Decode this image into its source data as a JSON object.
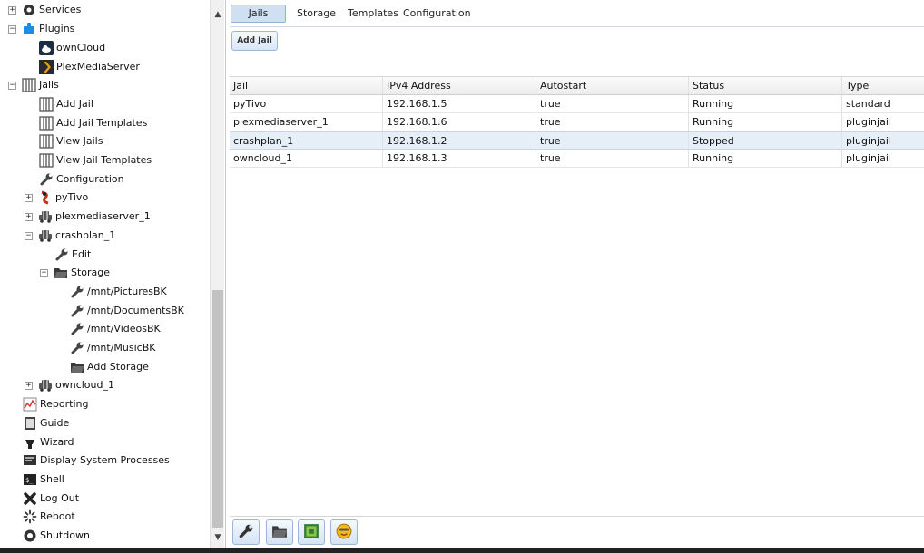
{
  "tree": {
    "items": [
      {
        "label": "Services",
        "icon": "services-gear-icon",
        "expander": "+"
      },
      {
        "label": "Plugins",
        "icon": "plugins-puzzle-icon",
        "expander": "−"
      },
      {
        "label": "ownCloud",
        "icon": "owncloud-cloud-icon"
      },
      {
        "label": "PlexMediaServer",
        "icon": "plex-chevron-icon"
      },
      {
        "label": "Jails",
        "icon": "jails-bars-icon",
        "expander": "−"
      },
      {
        "label": "Add Jail",
        "icon": "jail-bars-icon"
      },
      {
        "label": "Add Jail Templates",
        "icon": "jail-bars-icon"
      },
      {
        "label": "View Jails",
        "icon": "jail-bars-icon"
      },
      {
        "label": "View Jail Templates",
        "icon": "jail-bars-icon"
      },
      {
        "label": "Configuration",
        "icon": "wrench-icon"
      },
      {
        "label": "pyTivo",
        "icon": "pytivo-icon",
        "expander": "+"
      },
      {
        "label": "plexmediaserver_1",
        "icon": "jail-car-icon",
        "expander": "+"
      },
      {
        "label": "crashplan_1",
        "icon": "jail-car-icon",
        "expander": "−"
      },
      {
        "label": "Edit",
        "icon": "wrench-icon"
      },
      {
        "label": "Storage",
        "icon": "folder-icon",
        "expander": "−"
      },
      {
        "label": "/mnt/PicturesBK",
        "icon": "wrench-icon"
      },
      {
        "label": "/mnt/DocumentsBK",
        "icon": "wrench-icon"
      },
      {
        "label": "/mnt/VideosBK",
        "icon": "wrench-icon"
      },
      {
        "label": "/mnt/MusicBK",
        "icon": "wrench-icon"
      },
      {
        "label": "Add Storage",
        "icon": "folder-icon"
      },
      {
        "label": "owncloud_1",
        "icon": "jail-car-icon",
        "expander": "+"
      },
      {
        "label": "Reporting",
        "icon": "reporting-chart-icon"
      },
      {
        "label": "Guide",
        "icon": "guide-book-icon"
      },
      {
        "label": "Wizard",
        "icon": "wizard-hat-icon"
      },
      {
        "label": "Display System Processes",
        "icon": "processes-monitor-icon"
      },
      {
        "label": "Shell",
        "icon": "shell-terminal-icon"
      },
      {
        "label": "Log Out",
        "icon": "logout-x-icon"
      },
      {
        "label": "Reboot",
        "icon": "reboot-spinner-icon"
      },
      {
        "label": "Shutdown",
        "icon": "shutdown-power-icon"
      }
    ]
  },
  "tabs": {
    "jails": "Jails",
    "storage": "Storage",
    "templates": "Templates",
    "configuration": "Configuration"
  },
  "toolbar": {
    "add_jail_label": "Add Jail"
  },
  "grid": {
    "columns": [
      "Jail",
      "IPv4 Address",
      "Autostart",
      "Status",
      "Type"
    ],
    "rows": [
      [
        "pyTivo",
        "192.168.1.5",
        "true",
        "Running",
        "standard"
      ],
      [
        "plexmediaserver_1",
        "192.168.1.6",
        "true",
        "Running",
        "pluginjail"
      ],
      [
        "crashplan_1",
        "192.168.1.2",
        "true",
        "Stopped",
        "pluginjail"
      ],
      [
        "owncloud_1",
        "192.168.1.3",
        "true",
        "Running",
        "pluginjail"
      ]
    ],
    "selected_row": 2
  },
  "bottom_buttons": [
    "edit-wrench-icon",
    "storage-folder-icon",
    "start-jail-icon",
    "plugins-smiley-icon"
  ],
  "colors": {
    "accent": "#cfe0f3",
    "selected_row": "#e6eef8",
    "plugin_blue": "#1f8de0",
    "plex_orange": "#e5a00d"
  }
}
